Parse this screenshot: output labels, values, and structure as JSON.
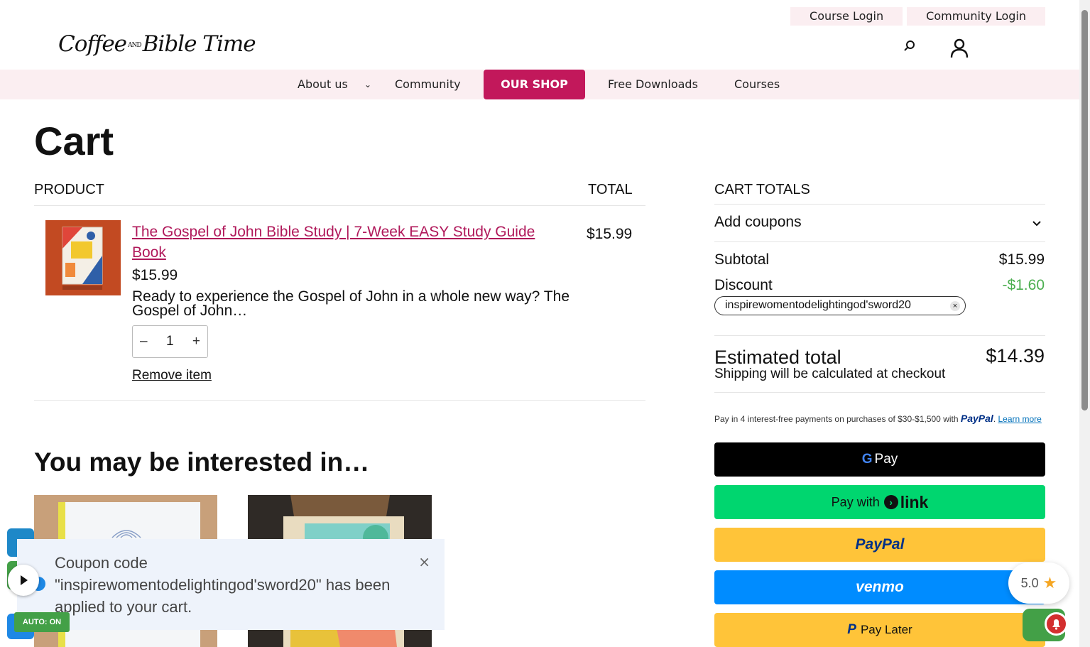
{
  "header": {
    "course_login": "Course Login",
    "community_login": "Community Login",
    "logo_text": "Coffee",
    "logo_and": "AND",
    "logo_text2": "Bible Time"
  },
  "nav": {
    "about": "About us",
    "community": "Community",
    "shop": "OUR SHOP",
    "downloads": "Free Downloads",
    "courses": "Courses"
  },
  "page": {
    "title": "Cart"
  },
  "cart": {
    "col_product": "PRODUCT",
    "col_total": "TOTAL",
    "item": {
      "title": "The Gospel of John Bible Study | 7-Week EASY Study Guide Book",
      "price": "$15.99",
      "description": "Ready to experience the Gospel of John in a whole new way? The Gospel of John…",
      "quantity": "1",
      "minus": "–",
      "plus": "+",
      "line_total": "$15.99",
      "remove": "Remove item"
    }
  },
  "recommendations": {
    "heading": "You may be interested in…"
  },
  "totals": {
    "heading": "CART TOTALS",
    "add_coupons": "Add coupons",
    "subtotal_label": "Subtotal",
    "subtotal_value": "$15.99",
    "discount_label": "Discount",
    "discount_value": "-$1.60",
    "coupon_code": "inspirewomentodelightingod'sword20",
    "coupon_remove": "×",
    "estimated_label": "Estimated total",
    "estimated_value": "$14.39",
    "shipping_note": "Shipping will be calculated at checkout",
    "paypal_msg_prefix": "Pay in 4 interest-free payments on purchases of $30-$1,500 with",
    "paypal_brand": "PayPal",
    "paypal_learn": "Learn more"
  },
  "payments": {
    "gpay": "Pay",
    "link_prefix": "Pay with",
    "link_brand": "link",
    "paypal": "PayPal",
    "venmo": "venmo",
    "paylater": "Pay Later"
  },
  "toast": {
    "message": "Coupon code \"inspirewomentodelightingod'sword20\" has been applied to your cart.",
    "close": "×"
  },
  "widgets": {
    "auto": "AUTO: ON",
    "rating": "5.0"
  },
  "colors": {
    "brand_pink": "#c2185b",
    "nav_bg": "#fbeef1",
    "discount_green": "#4caf50",
    "gpay_bg": "#000000",
    "link_bg": "#00d66f",
    "paypal_bg": "#ffc439",
    "venmo_bg": "#008cff"
  }
}
